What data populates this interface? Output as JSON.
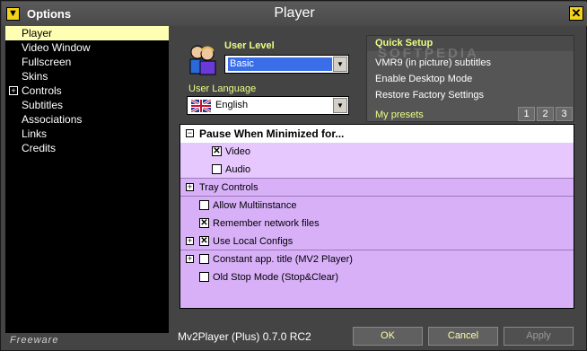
{
  "window": {
    "title": "Options",
    "page_title": "Player",
    "close_glyph": "✕",
    "title_icon_glyph": "▼"
  },
  "sidebar": {
    "items": [
      {
        "label": "Player",
        "active": true,
        "expandable": false
      },
      {
        "label": "Video Window",
        "active": false,
        "expandable": false
      },
      {
        "label": "Fullscreen",
        "active": false,
        "expandable": false
      },
      {
        "label": "Skins",
        "active": false,
        "expandable": false
      },
      {
        "label": "Controls",
        "active": false,
        "expandable": true
      },
      {
        "label": "Subtitles",
        "active": false,
        "expandable": false
      },
      {
        "label": "Associations",
        "active": false,
        "expandable": false
      },
      {
        "label": "Links",
        "active": false,
        "expandable": false
      },
      {
        "label": "Credits",
        "active": false,
        "expandable": false
      }
    ],
    "footer": "Freeware"
  },
  "user_panel": {
    "user_level_label": "User Level",
    "user_level_value": "Basic",
    "language_label": "User Language",
    "language_value": "English"
  },
  "quick_setup": {
    "title": "Quick Setup",
    "items": [
      "VMR9 (in picture) subtitles",
      "Enable Desktop Mode",
      "Restore Factory Settings"
    ],
    "presets_label": "My presets",
    "presets": [
      "1",
      "2",
      "3"
    ],
    "watermark": "SOFTPEDIA"
  },
  "options": {
    "group1_title": "Pause When Minimized for...",
    "video_label": "Video",
    "video_checked": true,
    "audio_label": "Audio",
    "audio_checked": false,
    "tray_label": "Tray Controls",
    "multi_label": "Allow Multiinstance",
    "multi_checked": false,
    "remember_label": "Remember network files",
    "remember_checked": true,
    "local_label": "Use Local Configs",
    "local_checked": true,
    "constant_label": "Constant app. title (MV2 Player)",
    "constant_checked": false,
    "oldstop_label": "Old Stop Mode (Stop&Clear)",
    "oldstop_checked": false,
    "expand_glyph": "+",
    "collapse_glyph": "−",
    "check_glyph": "✕"
  },
  "footer": {
    "version": "Mv2Player (Plus) 0.7.0 RC2",
    "ok_label": "OK",
    "cancel_label": "Cancel",
    "apply_label": "Apply"
  },
  "colors": {
    "accent_yellow": "#f2d21b",
    "label_yellow": "#eaff83",
    "options_bg": "#d8b0f8",
    "active_nav": "#ffffb4"
  }
}
